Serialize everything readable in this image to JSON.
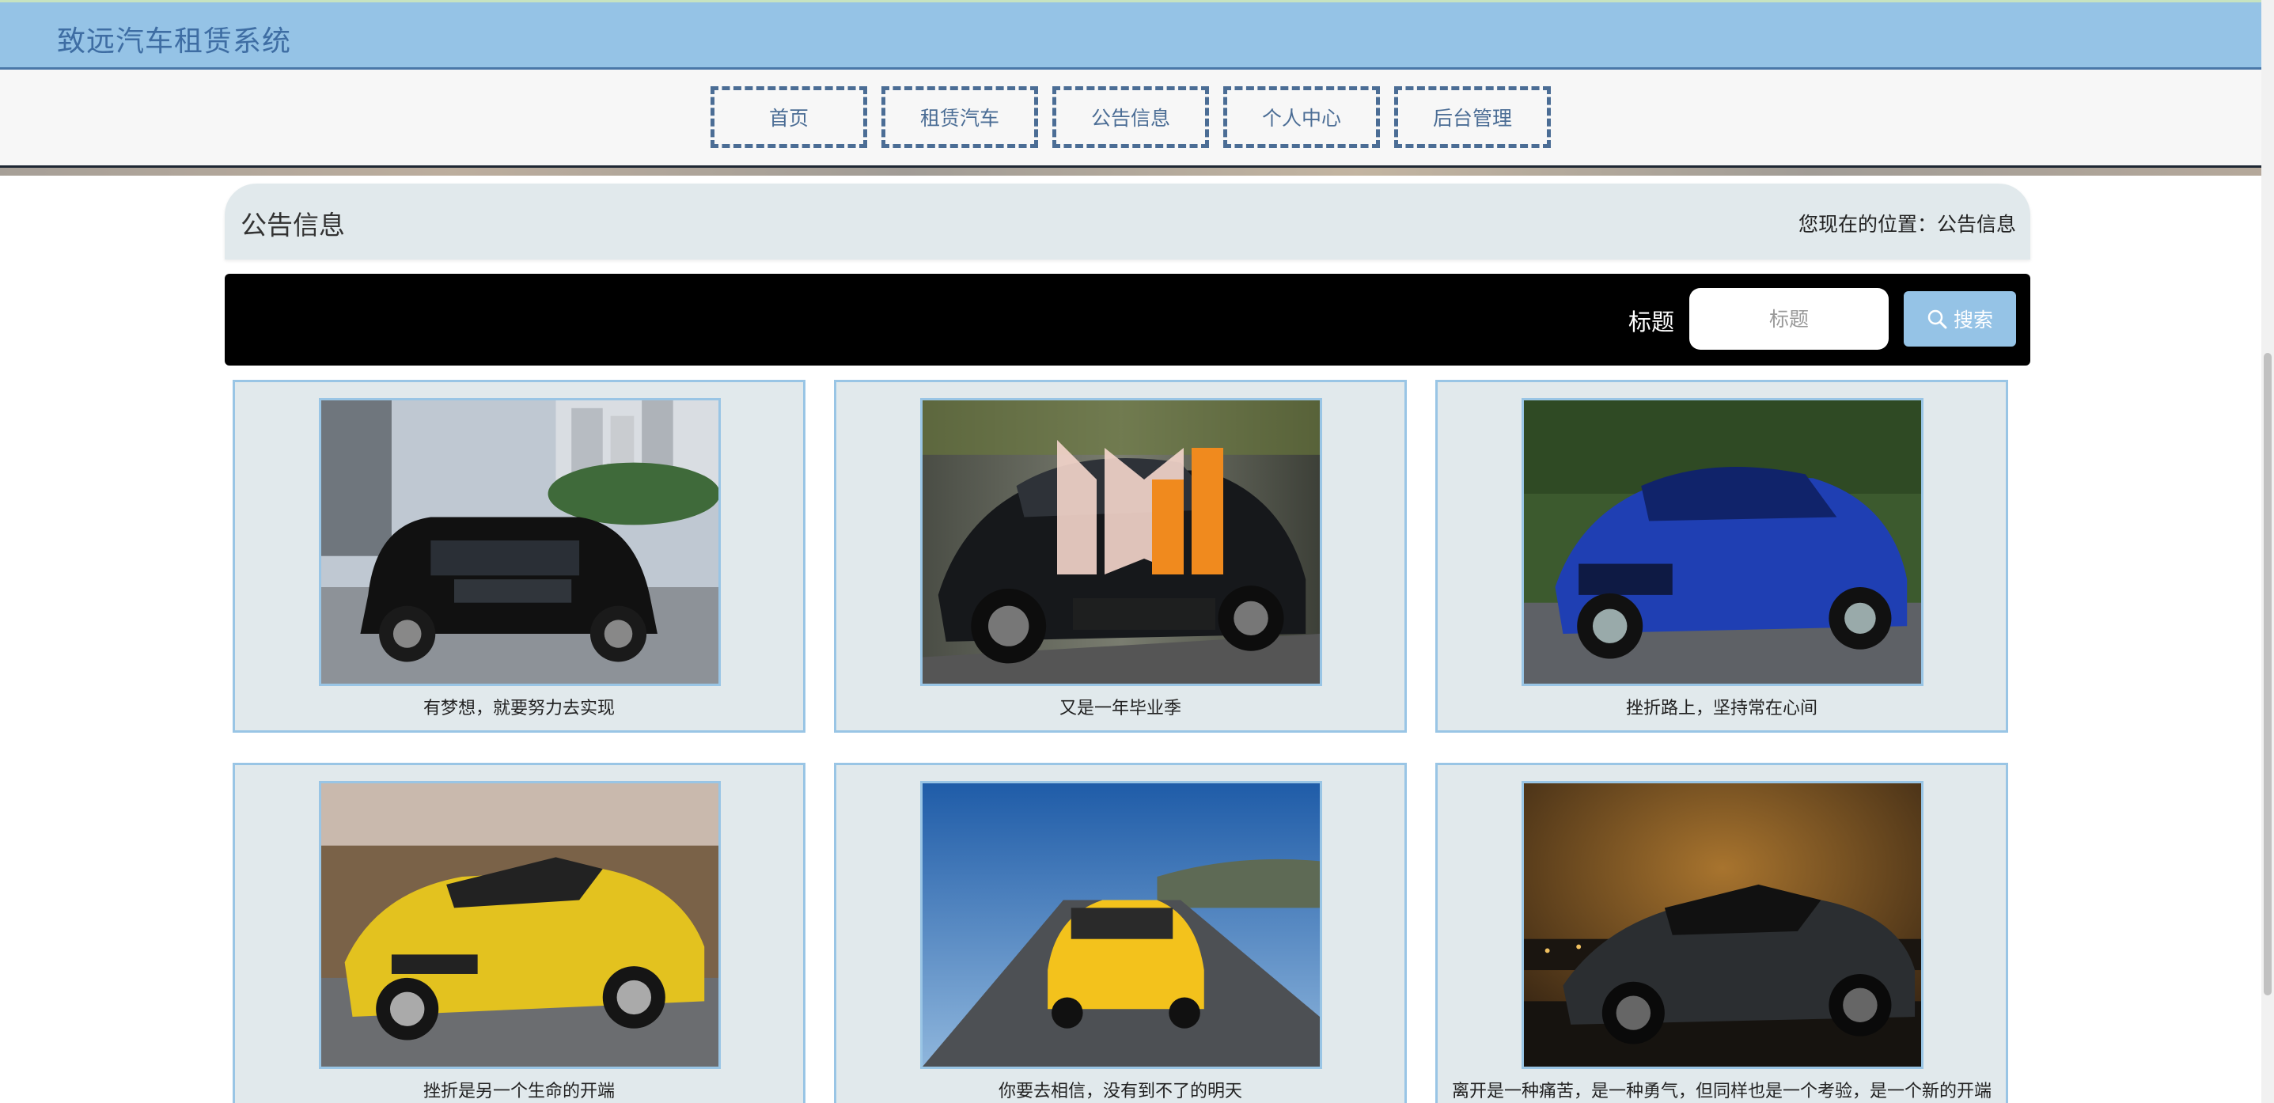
{
  "app": {
    "title": "致远汽车租赁系统"
  },
  "nav": {
    "items": [
      {
        "label": "首页"
      },
      {
        "label": "租赁汽车"
      },
      {
        "label": "公告信息"
      },
      {
        "label": "个人中心"
      },
      {
        "label": "后台管理"
      }
    ]
  },
  "page": {
    "title": "公告信息",
    "breadcrumb": "您现在的位置：公告信息"
  },
  "search": {
    "label": "标题",
    "placeholder": "标题",
    "button_label": "搜索"
  },
  "announcements": [
    {
      "caption": "有梦想，就要努力去实现",
      "image": "black-suv"
    },
    {
      "caption": "又是一年毕业季",
      "image": "black-sports-car"
    },
    {
      "caption": "挫折路上，坚持常在心间",
      "image": "blue-sports-car"
    },
    {
      "caption": "挫折是另一个生命的开端",
      "image": "yellow-muscle-car"
    },
    {
      "caption": "你要去相信，没有到不了的明天",
      "image": "yellow-sports-car"
    },
    {
      "caption": "离开是一种痛苦，是一种勇气，但同样也是一个考验，是一个新的开端",
      "image": "dark-supercar-night"
    }
  ],
  "watermark": {
    "image": "source-code-site-logo"
  },
  "colors": {
    "topbar": "#95c3e6",
    "nav_border": "#4b6d95",
    "card_bg": "#e1e9ec",
    "card_border": "#99c5e5",
    "search_bar": "#000000",
    "search_button": "#95c3e6"
  }
}
